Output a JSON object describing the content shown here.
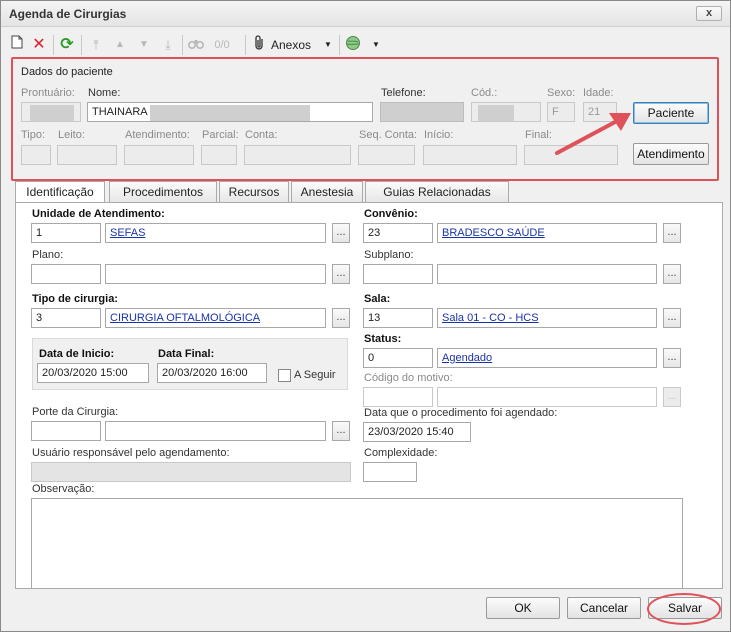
{
  "window": {
    "title": "Agenda de Cirurgias",
    "close_glyph": "x"
  },
  "toolbar": {
    "search_count": "0/0",
    "attachments_label": "Anexos",
    "icons": [
      "new-document-icon",
      "delete-icon",
      "refresh-icon",
      "first-record-icon",
      "previous-record-icon",
      "next-record-icon",
      "last-record-icon",
      "binoculars-icon",
      "paperclip-icon",
      "globe-icon"
    ]
  },
  "patient": {
    "section_title": "Dados do paciente",
    "labels": {
      "prontuario": "Prontuário:",
      "nome": "Nome:",
      "telefone": "Telefone:",
      "cod": "Cód.:",
      "sexo": "Sexo:",
      "idade": "Idade:",
      "tipo": "Tipo:",
      "leito": "Leito:",
      "atendimento": "Atendimento:",
      "parcial": "Parcial:",
      "conta": "Conta:",
      "seq_conta": "Seq. Conta:",
      "inicio": "Início:",
      "final": "Final:"
    },
    "values": {
      "nome": "THAINARA",
      "sexo": "F",
      "idade": "21"
    },
    "buttons": {
      "paciente": "Paciente",
      "atendimento": "Atendimento"
    }
  },
  "tabs": [
    "Identificação",
    "Procedimentos",
    "Recursos",
    "Anestesia",
    "Guias Relacionadas"
  ],
  "form": {
    "unidade": {
      "label": "Unidade de Atendimento:",
      "code": "1",
      "name": "SEFAS"
    },
    "convenio": {
      "label": "Convênio:",
      "code": "23",
      "name": "BRADESCO SAÚDE"
    },
    "plano": {
      "label": "Plano:"
    },
    "subplano": {
      "label": "Subplano:"
    },
    "tipo_cirurgia": {
      "label": "Tipo de cirurgia:",
      "code": "3",
      "name": "CIRURGIA OFTALMOLÓGICA"
    },
    "sala": {
      "label": "Sala:",
      "code": "13",
      "name": "Sala 01 - CO - HCS"
    },
    "status": {
      "label": "Status:",
      "code": "0",
      "name": "Agendado"
    },
    "codigo_motivo": {
      "label": "Código do motivo:"
    },
    "data_inicio": {
      "label": "Data de Inicio:",
      "value": "20/03/2020 15:00"
    },
    "data_final": {
      "label": "Data Final:",
      "value": "20/03/2020 16:00"
    },
    "a_seguir": {
      "label": "A Seguir"
    },
    "porte": {
      "label": "Porte da Cirurgia:"
    },
    "data_agendado": {
      "label": "Data que o procedimento foi agendado:",
      "value": "23/03/2020 15:40"
    },
    "usuario": {
      "label": "Usuário responsável pelo agendamento:"
    },
    "complexidade": {
      "label": "Complexidade:"
    },
    "observacao": {
      "label": "Observação:"
    },
    "ellipsis": "..."
  },
  "footer": {
    "ok": "OK",
    "cancelar": "Cancelar",
    "salvar": "Salvar"
  },
  "annotation_color": "#e0525a"
}
